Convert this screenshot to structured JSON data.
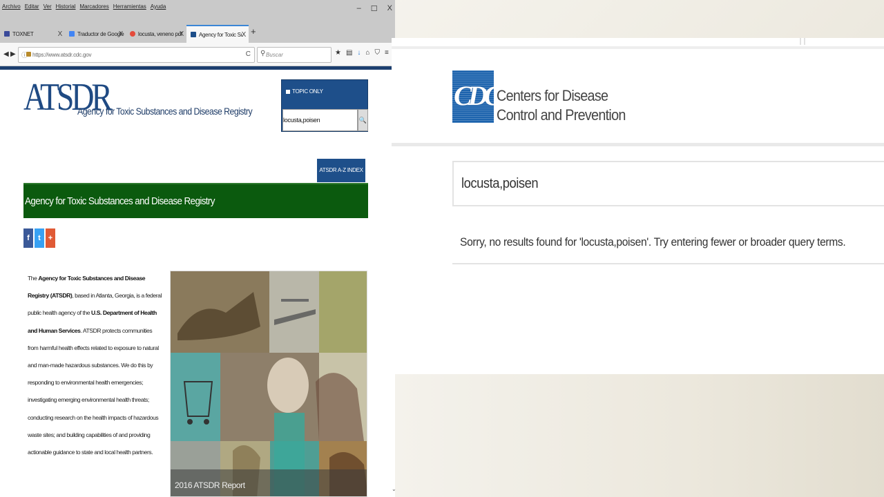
{
  "browser": {
    "menu": [
      "Archivo",
      "Editar",
      "Ver",
      "Historial",
      "Marcadores",
      "Herramientas",
      "Ayuda"
    ],
    "window_controls": [
      "–",
      "☐",
      "X"
    ],
    "tabs": [
      {
        "label": "TOXNET",
        "favicon_color": "#3a4a9a"
      },
      {
        "label": "Traductor de Google",
        "favicon_color": "#4285f4"
      },
      {
        "label": "locusta, veneno pdf - Busca",
        "favicon_color": "#e44b3b"
      },
      {
        "label": "Agency for Toxic Substance",
        "favicon_color": "#1e4f8a"
      }
    ],
    "tab_close": "X",
    "new_tab": "+",
    "url": "https://www.atsdr.cdc.gov",
    "search_placeholder": "Buscar",
    "nav_back": "◀",
    "nav_forward": "▶",
    "reload": "C",
    "toolbar_icons": [
      "★",
      "▤",
      "↓",
      "⌂",
      "⛉",
      "≡"
    ]
  },
  "atsdr": {
    "logo": "ATSDR",
    "logo_subtitle": "Agency for Toxic Substances and Disease Registry",
    "topic_only": "TOPIC ONLY",
    "search_value": "locusta,poisen",
    "search_button": "🔍",
    "az_index": "ATSDR A-Z INDEX ⌄",
    "band_title": "Agency for Toxic Substances and Disease Registry",
    "social": [
      "f",
      "t",
      "+"
    ],
    "intro": {
      "p1": "The ",
      "b1": "Agency for Toxic Substances and Disease Registry (ATSDR)",
      "p2": ", based in Atlanta, Georgia, is a federal public health agency of the ",
      "b2": "U.S. Department of Health and Human Services",
      "p3": ". ATSDR protects communities from harmful health effects related to exposure to natural and man-made hazardous substances. We do this by responding to environmental health emergencies; investigating emerging environmental health threats; conducting research on the health impacts of hazardous waste sites; and building capabilities of and providing actionable guidance to state and local health partners."
    },
    "collage_caption": "2016 ATSDR Report"
  },
  "cdc": {
    "logo_mark": "CDC",
    "name_line1": "Centers for Disease",
    "name_line2": "Control and Prevention",
    "search_value": "locusta,poisen",
    "no_results": "Sorry, no results found for 'locusta,poisen'. Try entering fewer or broader query terms."
  },
  "scroll_arrow": "⌄"
}
